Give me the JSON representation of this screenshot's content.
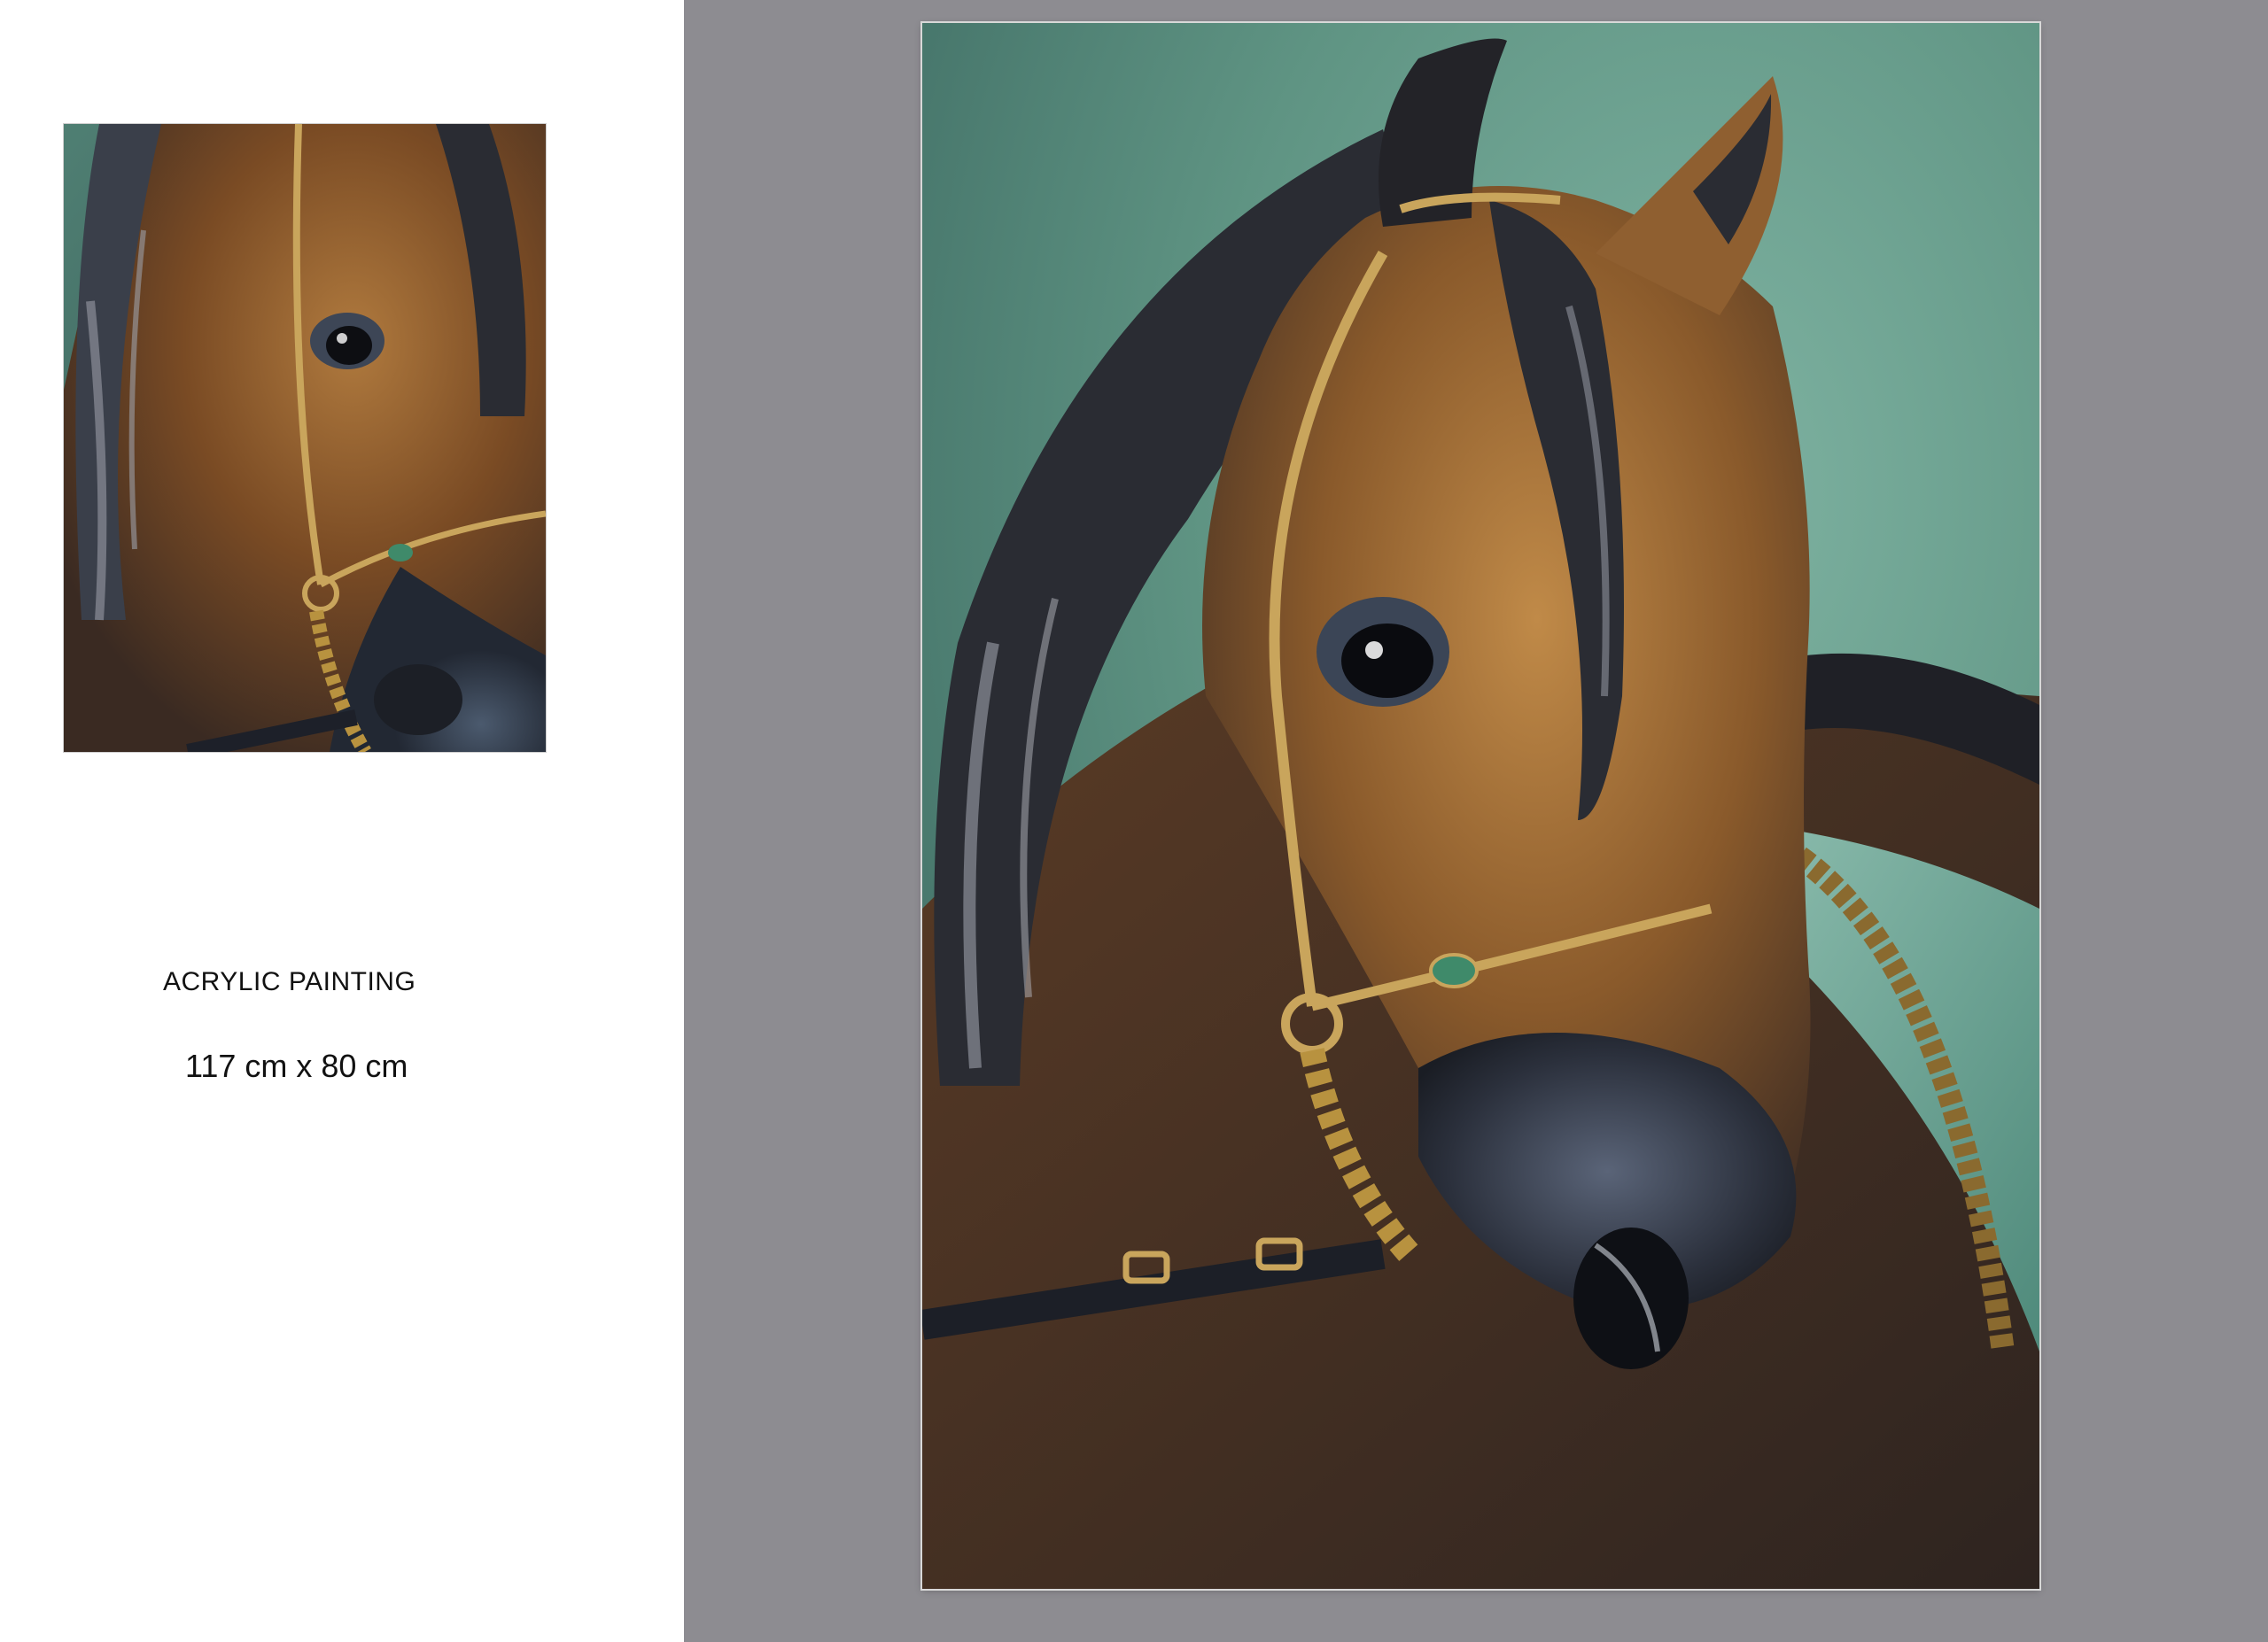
{
  "artwork": {
    "medium": "ACRYLIC PAINTING",
    "dimensions": "117 cm x 80 cm"
  },
  "colors": {
    "left_background": "#ffffff",
    "right_background": "#8d8c91",
    "painting_background": "#5f9483",
    "horse_coat": "#8a5a2b",
    "mane": "#2a2c33",
    "bridle": "#c9a55c"
  },
  "images": {
    "thumbnail": "horse-painting-detail",
    "main": "horse-painting-full"
  }
}
